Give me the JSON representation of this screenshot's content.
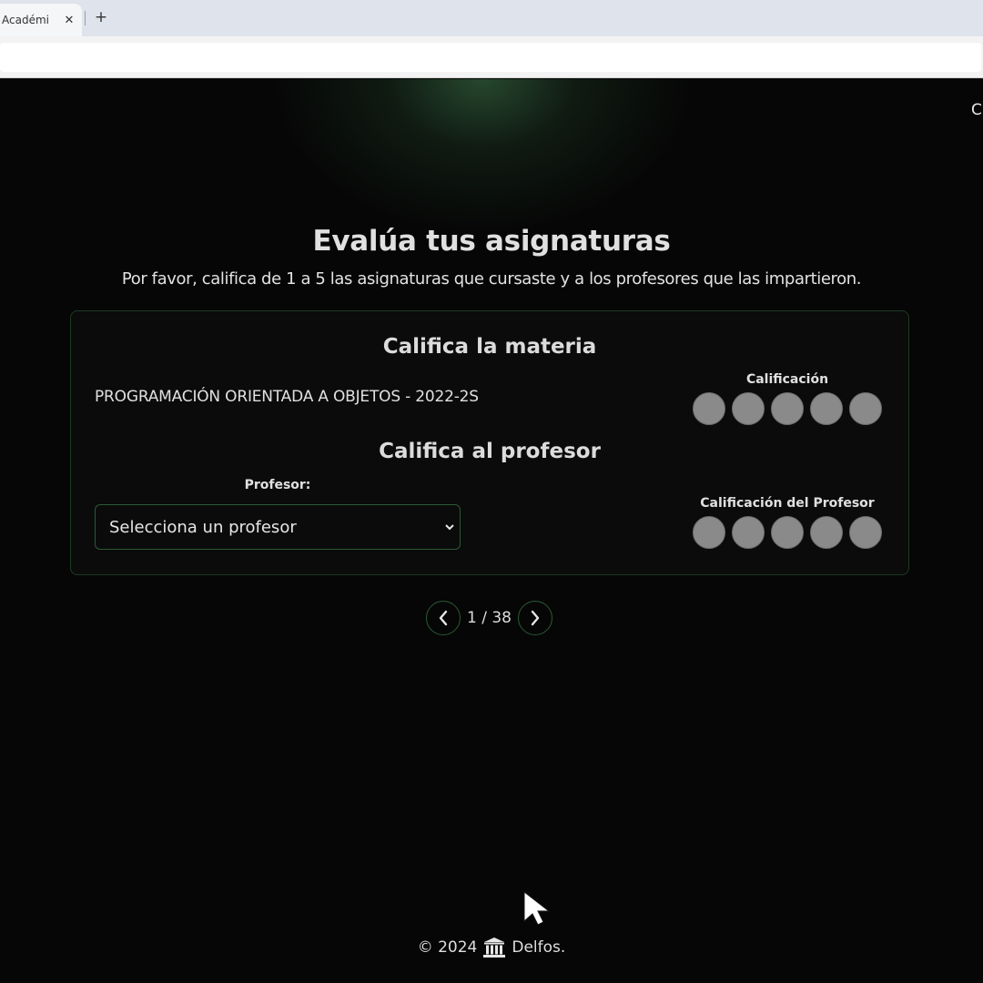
{
  "browser": {
    "tab_title": "Académi",
    "tab_close": "✕",
    "new_tab": "+"
  },
  "nav": {
    "fragment": "C"
  },
  "page": {
    "title": "Evalúa tus asignaturas",
    "subtitle": "Por favor, califica de 1 a 5 las asignaturas que cursaste y a los profesores que las impartieron."
  },
  "subject_card": {
    "heading": "Califica la materia",
    "subject_name": "PROGRAMACIÓN ORIENTADA A OBJETOS - 2022-2S",
    "rating_label": "Calificación",
    "rating_value": 0,
    "rating_max": 5
  },
  "professor_card": {
    "heading": "Califica al profesor",
    "professor_label": "Profesor:",
    "select_value": "Selecciona un profesor",
    "rating_label": "Calificación del Profesor",
    "rating_value": 0,
    "rating_max": 5
  },
  "pagination": {
    "current": "1",
    "total": "38",
    "text": "1 / 38"
  },
  "footer": {
    "copyright": "© 2024",
    "brand": "Delfos."
  },
  "colors": {
    "background": "#060606",
    "accent_border": "#2a5a36",
    "rating_dot": "#8a8a8a",
    "glow": "#284b30"
  },
  "icons": [
    "chevron-left-icon",
    "chevron-right-icon",
    "chevron-down-icon",
    "columns-logo-icon",
    "mouse-cursor-icon"
  ]
}
